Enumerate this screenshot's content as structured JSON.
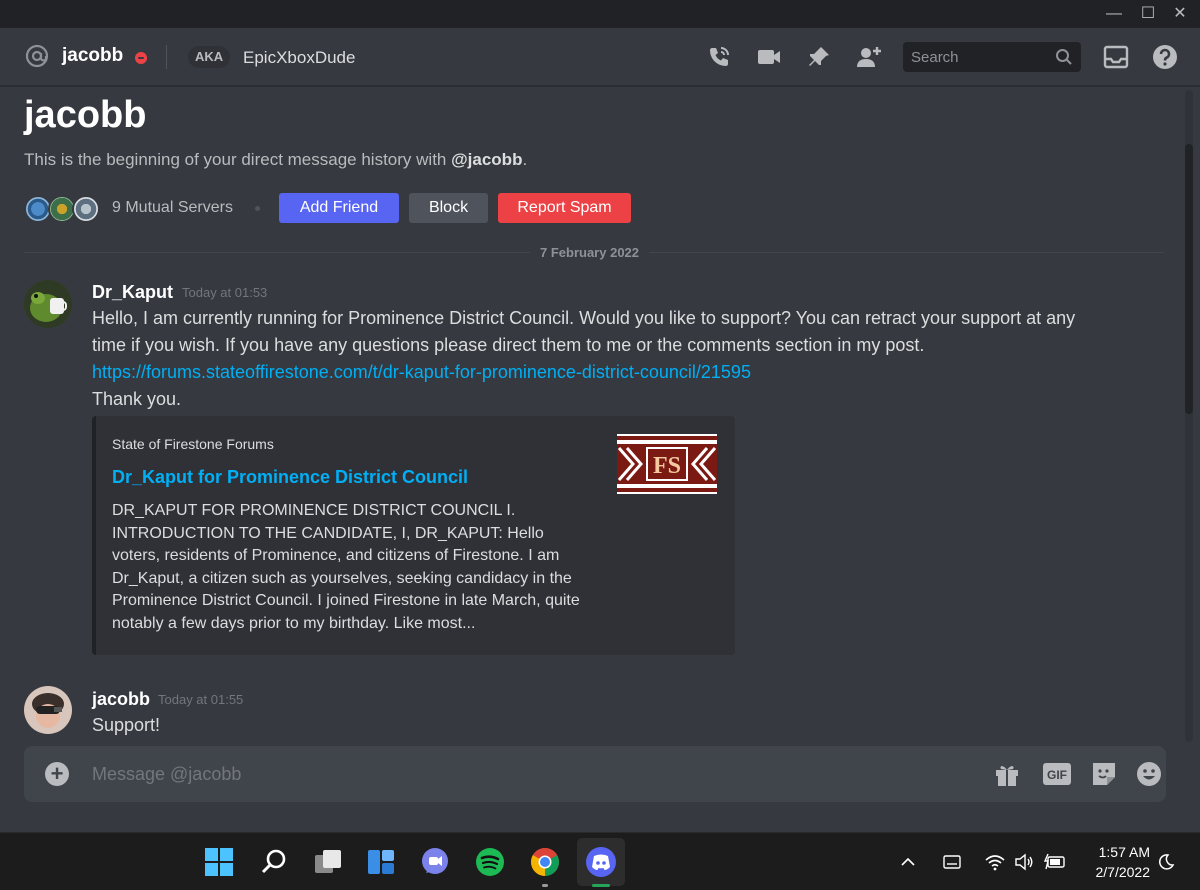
{
  "window": {
    "minimize": "—",
    "maximize": "☐",
    "close": "✕"
  },
  "header": {
    "title": "jacobb",
    "aka_badge": "AKA",
    "nickname": "EpicXboxDude",
    "search_placeholder": "Search"
  },
  "intro": {
    "title": "jacobb",
    "subtitle_prefix": "This is the beginning of your direct message history with ",
    "subtitle_mention": "@jacobb",
    "subtitle_suffix": ".",
    "mutual_servers": "9 Mutual Servers",
    "add_friend_label": "Add Friend",
    "block_label": "Block",
    "report_spam_label": "Report Spam"
  },
  "date_divider": "7 February 2022",
  "messages": [
    {
      "author": "Dr_Kaput",
      "timestamp": "Today at 01:53",
      "line1": "Hello, I am currently running for Prominence District Council. Would you like to support? You can retract your support at any",
      "line2": "time if you wish. If you have any questions please direct them to me or the comments section in my post.",
      "link": "https://forums.stateoffirestone.com/t/dr-kaput-for-prominence-district-council/21595",
      "line3": "Thank you.",
      "embed": {
        "provider": "State of Firestone Forums",
        "title": "Dr_Kaput for Prominence District Council",
        "description_lines": [
          "DR_KAPUT FOR PROMINENCE DISTRICT COUNCIL I.",
          "INTRODUCTION TO THE CANDIDATE, I, DR_KAPUT: Hello",
          "voters, residents of Prominence, and citizens of Firestone. I am",
          "Dr_Kaput, a citizen such as yourselves, seeking candidacy in the",
          "Prominence District Council. I joined Firestone in late March, quite",
          "notably a few days prior to my birthday. Like most..."
        ],
        "thumbnail_text": "FS"
      }
    },
    {
      "author": "jacobb",
      "timestamp": "Today at 01:55",
      "text": "Support!"
    }
  ],
  "composer": {
    "placeholder": "Message @jacobb"
  },
  "taskbar": {
    "time": "1:57 AM",
    "date": "2/7/2022"
  },
  "colors": {
    "blurple": "#5865f2",
    "danger": "#ed4245",
    "link": "#00aff4",
    "background": "#36393f",
    "spotify": "#1db954",
    "discord_active": "#23a55a"
  }
}
